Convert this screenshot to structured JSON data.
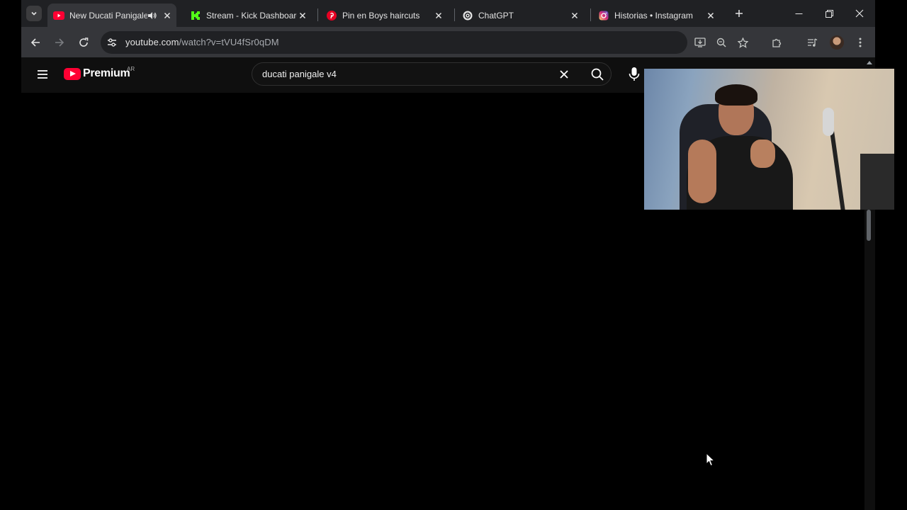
{
  "browser": {
    "tabs": [
      {
        "title": "New Ducati Panigale",
        "favicon": "youtube-icon",
        "active": true,
        "audio": true
      },
      {
        "title": "Stream - Kick Dashboard",
        "favicon": "kick-icon",
        "active": false
      },
      {
        "title": "Pin en Boys haircuts",
        "favicon": "pinterest-icon",
        "active": false
      },
      {
        "title": "ChatGPT",
        "favicon": "chatgpt-icon",
        "active": false
      },
      {
        "title": "Historias • Instagram",
        "favicon": "instagram-icon",
        "active": false
      }
    ],
    "url_host": "youtube.com",
    "url_path": "/watch?v=tVU4fSr0qDM",
    "colors": {
      "tabstrip": "#202124",
      "toolbar": "#35363a",
      "omnibox": "#202124"
    }
  },
  "youtube": {
    "brand": "Premium",
    "region": "AR",
    "search_query": "ducati panigale v4",
    "colors": {
      "accent": "#ff0033",
      "background": "#0f0f0f"
    }
  },
  "overlay": {
    "type": "webcam",
    "icon": "webcam-video"
  }
}
